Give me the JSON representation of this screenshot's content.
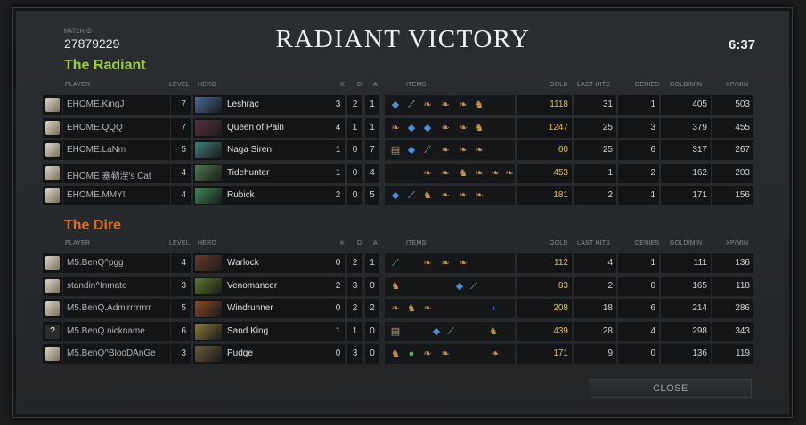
{
  "header": {
    "match_label": "MATCH ID",
    "match_id": "27879229",
    "title": "RADIANT VICTORY",
    "duration": "6:37"
  },
  "columns": {
    "player": "PLAYER",
    "level": "LEVEL",
    "hero": "HERO",
    "k": "K",
    "d": "D",
    "a": "A",
    "items": "ITEMS",
    "gold": "GOLD",
    "last_hits": "LAST HITS",
    "denies": "DENIES",
    "gpm": "GOLD/MIN",
    "xpm": "XP/MIN"
  },
  "radiant": {
    "name": "The Radiant",
    "color": "#9fce3a",
    "players": [
      {
        "player": "EHOME.KingJ",
        "level": "7",
        "hero": "Leshrac",
        "k": "3",
        "d": "2",
        "a": "1",
        "gold": "1118",
        "last_hits": "31",
        "denies": "1",
        "gpm": "405",
        "xpm": "503"
      },
      {
        "player": "EHOME.QQQ",
        "level": "7",
        "hero": "Queen of Pain",
        "k": "4",
        "d": "1",
        "a": "1",
        "gold": "1247",
        "last_hits": "25",
        "denies": "3",
        "gpm": "379",
        "xpm": "455"
      },
      {
        "player": "EHOME.LaNm",
        "level": "5",
        "hero": "Naga Siren",
        "k": "1",
        "d": "0",
        "a": "7",
        "gold": "60",
        "last_hits": "25",
        "denies": "6",
        "gpm": "317",
        "xpm": "267"
      },
      {
        "player": "EHOME 塞勒涅's Cat",
        "level": "4",
        "hero": "Tidehunter",
        "k": "1",
        "d": "0",
        "a": "4",
        "gold": "453",
        "last_hits": "1",
        "denies": "2",
        "gpm": "162",
        "xpm": "203"
      },
      {
        "player": "EHOME.MMY!",
        "level": "4",
        "hero": "Rubick",
        "k": "2",
        "d": "0",
        "a": "5",
        "gold": "181",
        "last_hits": "2",
        "denies": "1",
        "gpm": "171",
        "xpm": "156"
      }
    ]
  },
  "dire": {
    "name": "The Dire",
    "color": "#e06a1e",
    "players": [
      {
        "player": "M5.BenQ^pgg",
        "level": "4",
        "hero": "Warlock",
        "k": "0",
        "d": "2",
        "a": "1",
        "gold": "112",
        "last_hits": "4",
        "denies": "1",
        "gpm": "111",
        "xpm": "136"
      },
      {
        "player": "standin^Inmate",
        "level": "3",
        "hero": "Venomancer",
        "k": "2",
        "d": "3",
        "a": "0",
        "gold": "83",
        "last_hits": "2",
        "denies": "0",
        "gpm": "165",
        "xpm": "118"
      },
      {
        "player": "M5.BenQ.Admirrrrrrrr",
        "level": "5",
        "hero": "Windrunner",
        "k": "0",
        "d": "2",
        "a": "2",
        "gold": "208",
        "last_hits": "18",
        "denies": "6",
        "gpm": "214",
        "xpm": "286"
      },
      {
        "player": "M5.BenQ.nickname",
        "level": "6",
        "hero": "Sand King",
        "k": "1",
        "d": "1",
        "a": "0",
        "gold": "439",
        "last_hits": "28",
        "denies": "4",
        "gpm": "298",
        "xpm": "343"
      },
      {
        "player": "M5.BenQ^BlooDAnGe",
        "level": "3",
        "hero": "Pudge",
        "k": "0",
        "d": "3",
        "a": "0",
        "gold": "171",
        "last_hits": "9",
        "denies": "0",
        "gpm": "136",
        "xpm": "119"
      }
    ]
  },
  "dire_avatar_4_glyph": "?",
  "close_label": "CLOSE",
  "colors": {
    "gold": "#e8c230",
    "background": "#26292c"
  }
}
